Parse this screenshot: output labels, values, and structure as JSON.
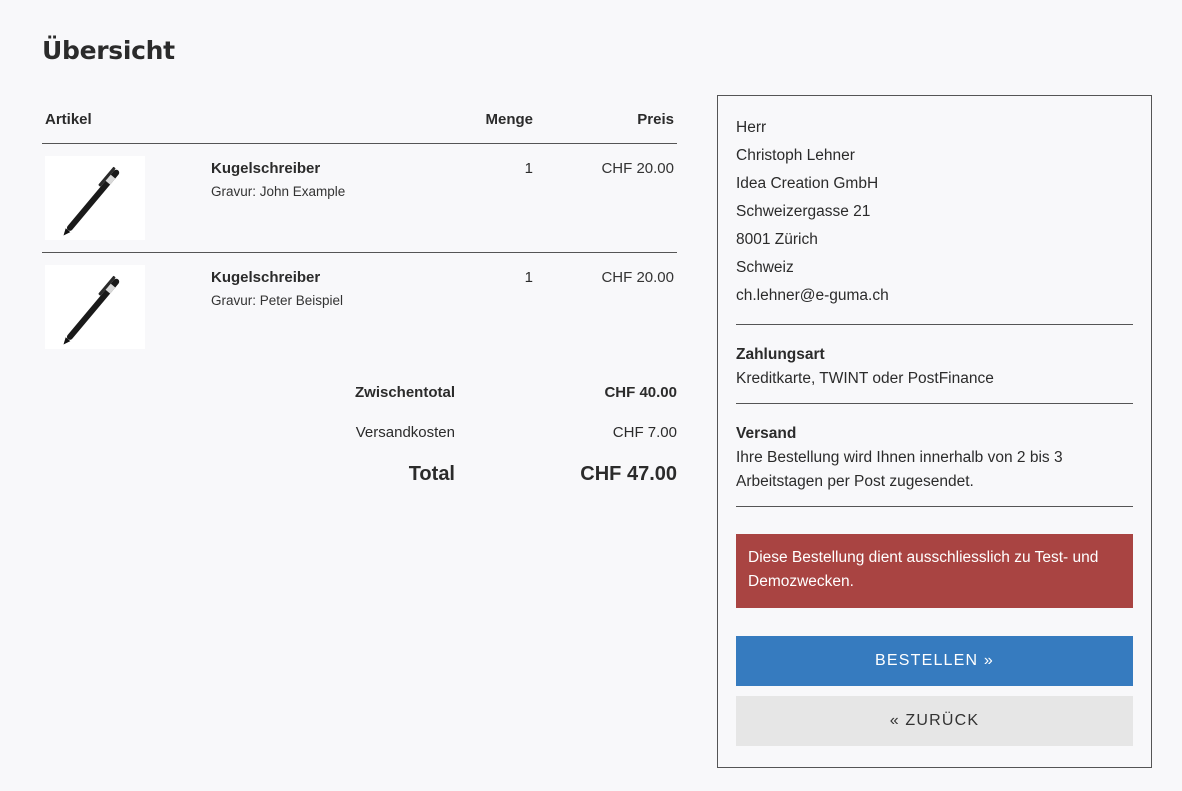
{
  "page": {
    "title": "Übersicht"
  },
  "order": {
    "columns": {
      "article": "Artikel",
      "quantity": "Menge",
      "price": "Preis"
    },
    "items": [
      {
        "name": "Kugelschreiber",
        "engraving": "Gravur: John Example",
        "quantity": "1",
        "price": "CHF 20.00",
        "image_icon": "pen-image"
      },
      {
        "name": "Kugelschreiber",
        "engraving": "Gravur: Peter Beispiel",
        "quantity": "1",
        "price": "CHF 20.00",
        "image_icon": "pen-image"
      }
    ],
    "totals": {
      "subtotal_label": "Zwischentotal",
      "subtotal_value": "CHF 40.00",
      "shipping_label": "Versandkosten",
      "shipping_value": "CHF 7.00",
      "total_label": "Total",
      "total_value": "CHF 47.00"
    }
  },
  "summary": {
    "address": {
      "salutation": "Herr",
      "name": "Christoph Lehner",
      "company": "Idea Creation GmbH",
      "street": "Schweizergasse 21",
      "city": "8001 Zürich",
      "country": "Schweiz",
      "email": "ch.lehner@e-guma.ch"
    },
    "payment": {
      "heading": "Zahlungsart",
      "text": "Kreditkarte, TWINT oder PostFinance"
    },
    "shipping": {
      "heading": "Versand",
      "text": "Ihre Bestellung wird Ihnen innerhalb von 2 bis 3 Arbeitstagen per Post zugesendet."
    },
    "notice": "Diese Bestellung dient ausschliesslich zu Test- und Demozwecken.",
    "order_button": "BESTELLEN »",
    "back_button": "« ZURÜCK"
  },
  "colors": {
    "primary_button": "#367bbf",
    "alert": "#a94442",
    "secondary_button": "#e6e6e6"
  }
}
